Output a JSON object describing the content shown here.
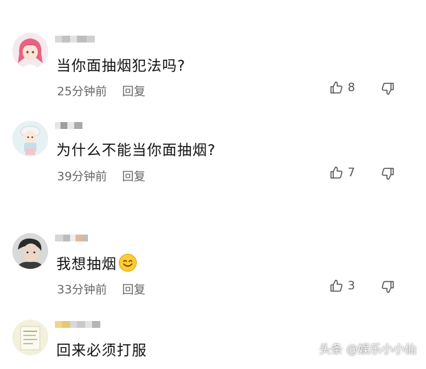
{
  "comments": [
    {
      "text": "当你面抽烟犯法吗?",
      "time": "25分钟前",
      "reply": "回复",
      "likes": "8",
      "avatar_icon": "anime-girl-avatar-icon"
    },
    {
      "text": "为什么不能当你面抽烟?",
      "time": "39分钟前",
      "reply": "回复",
      "likes": "7",
      "avatar_icon": "cartoon-character-avatar-icon"
    },
    {
      "text": "我想抽烟",
      "time": "33分钟前",
      "reply": "回复",
      "likes": "3",
      "avatar_icon": "person-photo-avatar-icon"
    },
    {
      "text": "回来必须打服",
      "time": "",
      "reply": "",
      "likes": "",
      "avatar_icon": "document-avatar-icon"
    }
  ],
  "watermark": "头条 @娱乐小小仙",
  "colors": {
    "text": "#111111",
    "meta": "#666666",
    "background": "#ffffff"
  }
}
